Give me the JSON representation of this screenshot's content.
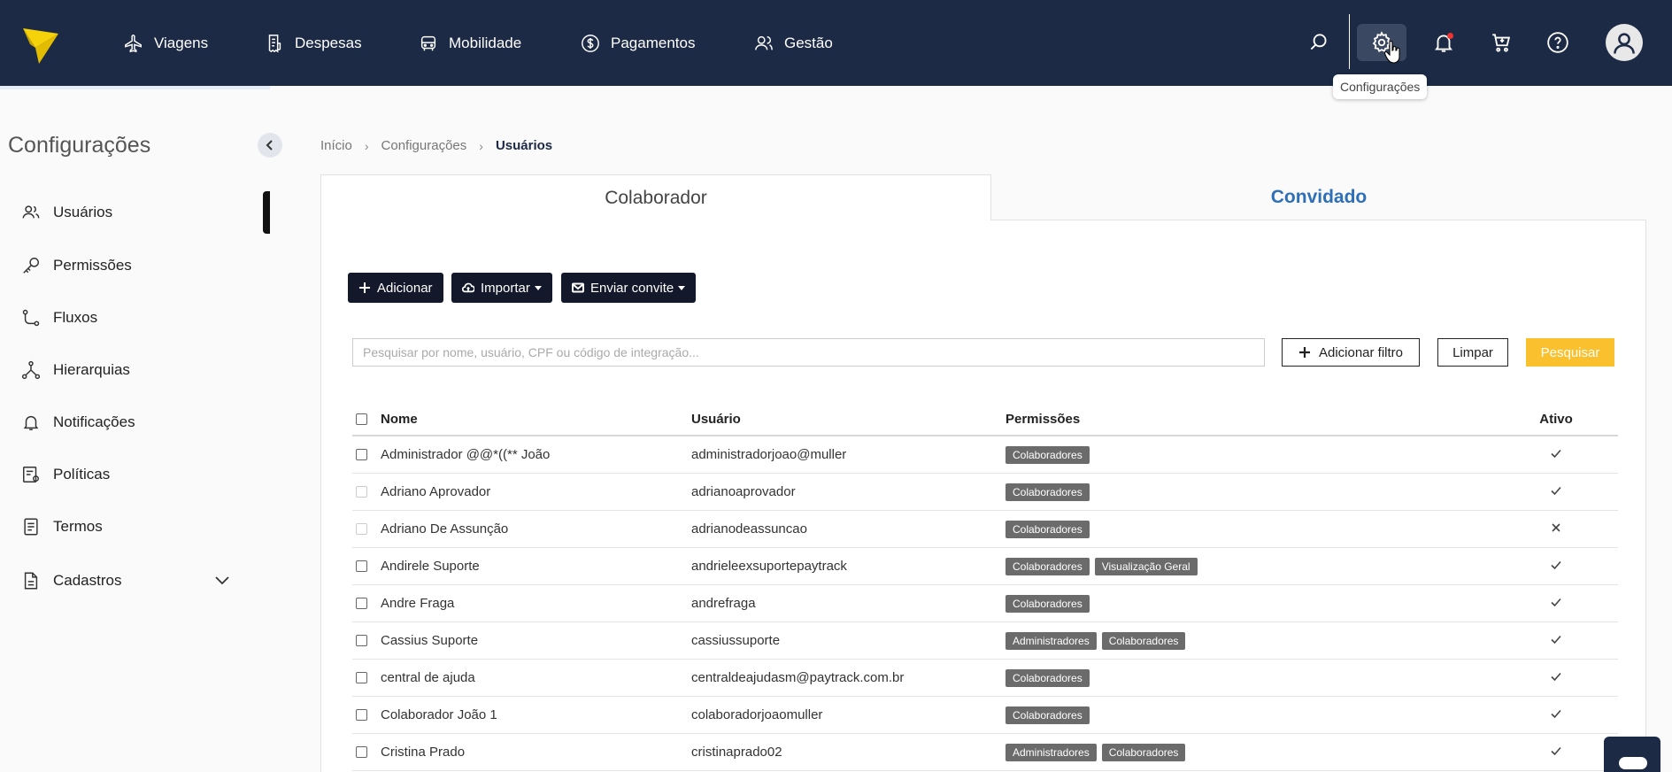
{
  "topbar": {
    "nav": [
      {
        "label": "Viagens",
        "icon": "plane-icon"
      },
      {
        "label": "Despesas",
        "icon": "receipt-icon"
      },
      {
        "label": "Mobilidade",
        "icon": "car-icon"
      },
      {
        "label": "Pagamentos",
        "icon": "dollar-icon"
      },
      {
        "label": "Gestão",
        "icon": "people-icon"
      }
    ],
    "tooltip": "Configurações",
    "colors": {
      "background": "#1c2a45",
      "notification_dot": "#e33333"
    }
  },
  "sidebar": {
    "title": "Configurações",
    "items": [
      {
        "label": "Usuários",
        "icon": "users-icon",
        "active": true
      },
      {
        "label": "Permissões",
        "icon": "key-icon"
      },
      {
        "label": "Fluxos",
        "icon": "flow-icon"
      },
      {
        "label": "Hierarquias",
        "icon": "hierarchy-icon"
      },
      {
        "label": "Notificações",
        "icon": "bell-icon"
      },
      {
        "label": "Políticas",
        "icon": "policy-icon"
      },
      {
        "label": "Termos",
        "icon": "document-icon"
      },
      {
        "label": "Cadastros",
        "icon": "file-icon",
        "expandable": true
      }
    ]
  },
  "breadcrumb": {
    "items": [
      "Início",
      "Configurações",
      "Usuários"
    ]
  },
  "tabs": {
    "collaborator": "Colaborador",
    "guest": "Convidado"
  },
  "toolbar": {
    "add": "Adicionar",
    "import": "Importar",
    "invite": "Enviar convite"
  },
  "search": {
    "placeholder": "Pesquisar por nome, usuário, CPF ou código de integração...",
    "add_filter": "Adicionar filtro",
    "clear": "Limpar",
    "search": "Pesquisar",
    "accent_color": "#fbc02d"
  },
  "table": {
    "headers": {
      "name": "Nome",
      "user": "Usuário",
      "permissions": "Permissões",
      "active": "Ativo"
    },
    "rows": [
      {
        "name": "Administrador @@*((** João",
        "user": "administradorjoao@muller",
        "permissions": [
          "Colaboradores"
        ],
        "active": true,
        "selectable": true
      },
      {
        "name": "Adriano Aprovador",
        "user": "adrianoaprovador",
        "permissions": [
          "Colaboradores"
        ],
        "active": true,
        "selectable": false
      },
      {
        "name": "Adriano De Assunção",
        "user": "adrianodeassuncao",
        "permissions": [
          "Colaboradores"
        ],
        "active": false,
        "selectable": false
      },
      {
        "name": "Andirele Suporte",
        "user": "andrieleexsuportepaytrack",
        "permissions": [
          "Colaboradores",
          "Visualização Geral"
        ],
        "active": true,
        "selectable": true
      },
      {
        "name": "Andre Fraga",
        "user": "andrefraga",
        "permissions": [
          "Colaboradores"
        ],
        "active": true,
        "selectable": true
      },
      {
        "name": "Cassius Suporte",
        "user": "cassiussuporte",
        "permissions": [
          "Administradores",
          "Colaboradores"
        ],
        "active": true,
        "selectable": true
      },
      {
        "name": "central de ajuda",
        "user": "centraldeajudasm@paytrack.com.br",
        "permissions": [
          "Colaboradores"
        ],
        "active": true,
        "selectable": true
      },
      {
        "name": "Colaborador João 1",
        "user": "colaboradorjoaomuller",
        "permissions": [
          "Colaboradores"
        ],
        "active": true,
        "selectable": true
      },
      {
        "name": "Cristina Prado",
        "user": "cristinaprado02",
        "permissions": [
          "Administradores",
          "Colaboradores"
        ],
        "active": true,
        "selectable": true
      }
    ]
  }
}
